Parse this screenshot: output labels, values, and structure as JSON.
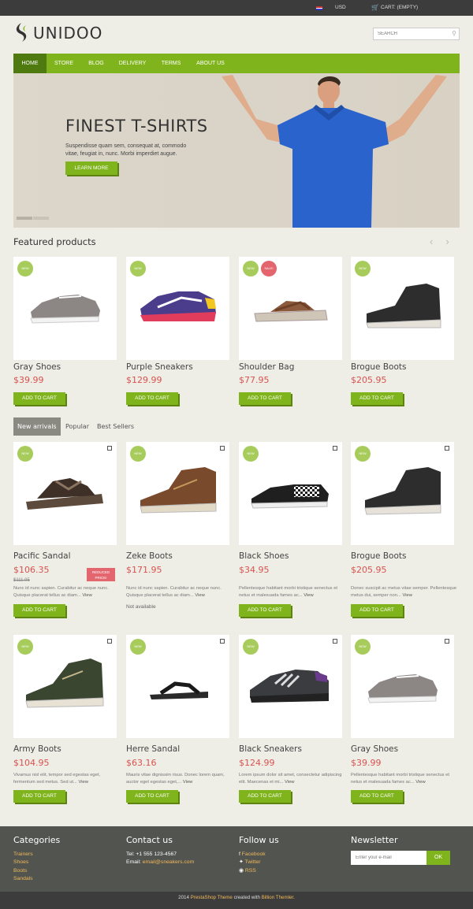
{
  "topbar": {
    "currency": "USD",
    "cart": "CART: (EMPTY)"
  },
  "header": {
    "logo": "UNIDOO",
    "search_placeholder": "SEARCH"
  },
  "nav": [
    "HOME",
    "STORE",
    "BLOG",
    "DELIVERY",
    "TERMS",
    "ABOUT US"
  ],
  "hero": {
    "title": "FINEST T-SHIRTS",
    "text": "Suspendisse quam sem, consequat at, commodo vitae, feugiat in, nunc. Morbi imperdiet augue.",
    "button": "LEARN MORE"
  },
  "featured": {
    "title": "Featured products",
    "items": [
      {
        "name": "Gray Shoes",
        "price": "$39.99",
        "button": "ADD TO CART",
        "badge": "NEW"
      },
      {
        "name": "Purple Sneakers",
        "price": "$129.99",
        "button": "ADD TO CART",
        "badge": "NEW"
      },
      {
        "name": "Shoulder Bag",
        "price": "$77.95",
        "button": "ADD TO CART",
        "badge": "NEW",
        "sale": "SALE!"
      },
      {
        "name": "Brogue Boots",
        "price": "$205.95",
        "button": "ADD TO CART",
        "badge": "NEW"
      }
    ]
  },
  "tabs": [
    "New arrivals",
    "Popular",
    "Best Sellers"
  ],
  "products": [
    {
      "name": "Pacific Sandal",
      "price": "$106.35",
      "old_price": "$111.95",
      "reduced": "REDUCED PRICE!",
      "desc": "Nunc id nunc sapien. Curabitur ac neque nunc. Quisque placerat tellus ac diam...",
      "view": "View",
      "button": "ADD TO CART",
      "badge": "NEW"
    },
    {
      "name": "Zeke Boots",
      "price": "$171.95",
      "desc": "Nunc id nunc sapien. Curabitur ac neque nunc. Quisque placerat tellus ac diam...",
      "view": "View",
      "status": "Not available",
      "badge": "NEW"
    },
    {
      "name": "Black Shoes",
      "price": "$34.95",
      "desc": "Pellentesque habitant morbi tristique senectus et netus et malesuada fames ac...",
      "view": "View",
      "button": "ADD TO CART",
      "badge": "NEW"
    },
    {
      "name": "Brogue Boots",
      "price": "$205.95",
      "desc": "Donec suscipit ac metus vitae semper. Pellentesque metus dui, semper non...",
      "view": "View",
      "button": "ADD TO CART",
      "badge": "NEW"
    },
    {
      "name": "Army Boots",
      "price": "$104.95",
      "desc": "Vivamus nisl elit, tempor sed egestas eget, fermentum sed metus. Sed ut...",
      "view": "View",
      "button": "ADD TO CART",
      "badge": "NEW"
    },
    {
      "name": "Herre Sandal",
      "price": "$63.16",
      "desc": "Mauris vitae dignissim risus. Donec lorem quam, auctor eget egestas eget,...",
      "view": "View",
      "button": "ADD TO CART",
      "badge": "NEW"
    },
    {
      "name": "Black Sneakers",
      "price": "$124.99",
      "desc": "Lorem ipsum dolor sit amet, consectetur adipiscing elit. Maecenas et mi...",
      "view": "View",
      "button": "ADD TO CART",
      "badge": "NEW"
    },
    {
      "name": "Gray Shoes",
      "price": "$39.99",
      "desc": "Pellentesque habitant morbi tristique senectus et netus et malesuada fames ac...",
      "view": "View",
      "button": "ADD TO CART",
      "badge": "NEW"
    }
  ],
  "footer": {
    "categories_title": "Categories",
    "categories": [
      "Trainers",
      "Shoes",
      "Boots",
      "Sandals"
    ],
    "contact_title": "Contact us",
    "tel": "Tel: +1 555 123-4567",
    "email_label": "Email:",
    "email": "email@sneakers.com",
    "follow_title": "Follow us",
    "follow": [
      "Facebook",
      "Twitter",
      "RSS"
    ],
    "newsletter_title": "Newsletter",
    "newsletter_placeholder": "Enter your e-mail",
    "newsletter_button": "OK"
  },
  "copyright": {
    "year": "2014",
    "theme": "PrestaShop Theme",
    "created": "created with",
    "author": "Billion Themler."
  },
  "colors": {
    "accent": "#7fb41c",
    "price": "#d9534f",
    "footer": "#52544f"
  }
}
